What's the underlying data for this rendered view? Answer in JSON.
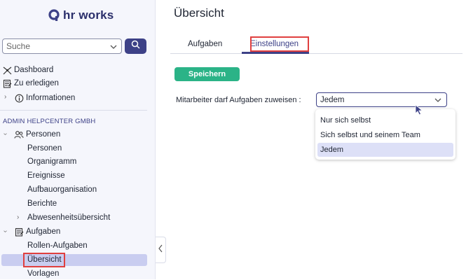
{
  "sidebar": {
    "logo_text": "hr works",
    "search_placeholder": "Suche",
    "top_items": [
      {
        "label": "Dashboard",
        "icon": "dashboard-icon"
      },
      {
        "label": "Zu erledigen",
        "icon": "checklist-icon"
      },
      {
        "label": "Informationen",
        "icon": "info-icon"
      }
    ],
    "section_label": "ADMIN HELPCENTER GMBH",
    "groups": [
      {
        "label": "Personen",
        "icon": "people-icon",
        "items": [
          "Personen",
          "Organigramm",
          "Ereignisse",
          "Aufbauorganisation",
          "Berichte",
          "Abwesenheitsübersicht"
        ]
      },
      {
        "label": "Aufgaben",
        "icon": "tasks-icon",
        "items": [
          "Rollen-Aufgaben",
          "Übersicht",
          "Vorlagen"
        ]
      }
    ],
    "active_item": "Übersicht"
  },
  "main": {
    "title": "Übersicht",
    "tabs": [
      {
        "label": "Aufgaben",
        "active": false
      },
      {
        "label": "Einstellungen",
        "active": true
      }
    ],
    "save_label": "Speichern",
    "field_label": "Mitarbeiter darf Aufgaben zuweisen :",
    "select_value": "Jedem",
    "options": [
      "Nur sich selbst",
      "Sich selbst und seinem Team",
      "Jedem"
    ],
    "selected_option": "Jedem"
  },
  "colors": {
    "brand": "#3d4187",
    "save_button": "#2bb387",
    "highlight_box": "#e0403f",
    "active_item_bg": "#c9cdf0",
    "selected_option_bg": "#dde0f7"
  }
}
